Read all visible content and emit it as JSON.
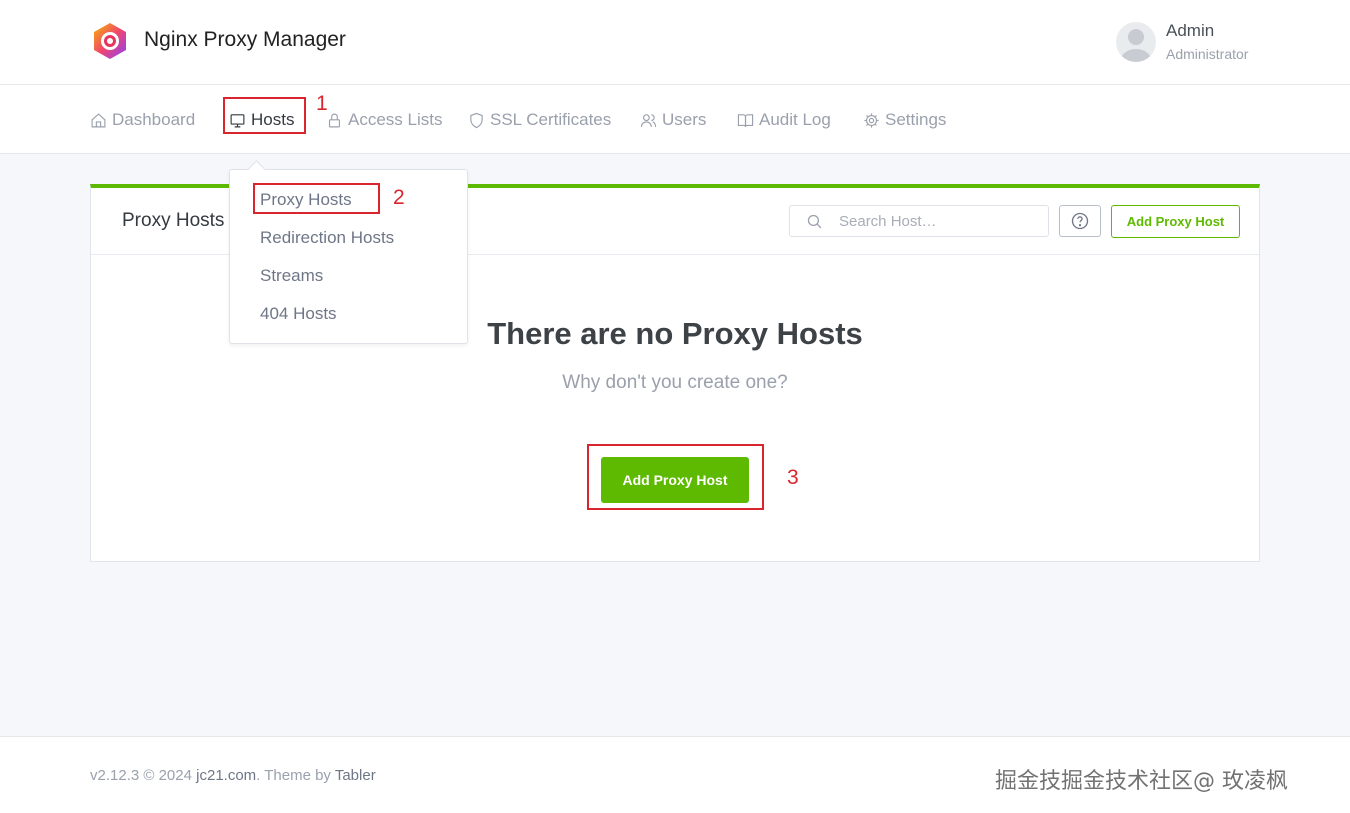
{
  "app": {
    "brand": "Nginx Proxy Manager",
    "user_name": "Admin",
    "user_role": "Administrator"
  },
  "nav": {
    "items": [
      {
        "label": "Dashboard",
        "icon": "home-icon"
      },
      {
        "label": "Hosts",
        "icon": "monitor-icon",
        "active": true
      },
      {
        "label": "Access Lists",
        "icon": "lock-icon"
      },
      {
        "label": "SSL Certificates",
        "icon": "shield-icon"
      },
      {
        "label": "Users",
        "icon": "users-icon"
      },
      {
        "label": "Audit Log",
        "icon": "book-icon"
      },
      {
        "label": "Settings",
        "icon": "gear-icon"
      }
    ]
  },
  "dropdown": {
    "items": [
      "Proxy Hosts",
      "Redirection Hosts",
      "Streams",
      "404 Hosts"
    ]
  },
  "card": {
    "title": "Proxy Hosts",
    "search_placeholder": "Search Host…",
    "add_button": "Add Proxy Host",
    "empty_title": "There are no Proxy Hosts",
    "empty_subtitle": "Why don't you create one?",
    "empty_add_button": "Add Proxy Host"
  },
  "annotations": {
    "step1": "1",
    "step2": "2",
    "step3": "3",
    "color": "#d9262e"
  },
  "footer": {
    "version": "v2.12.3 © 2024 ",
    "link": "jc21.com",
    "theme_prefix": ". Theme by ",
    "theme_link": "Tabler",
    "watermark": "掘金技掘金技术社区@ 玫凌枫"
  },
  "colors": {
    "accent": "#5eba00",
    "text": "#495057",
    "muted": "#9aa0ac"
  }
}
